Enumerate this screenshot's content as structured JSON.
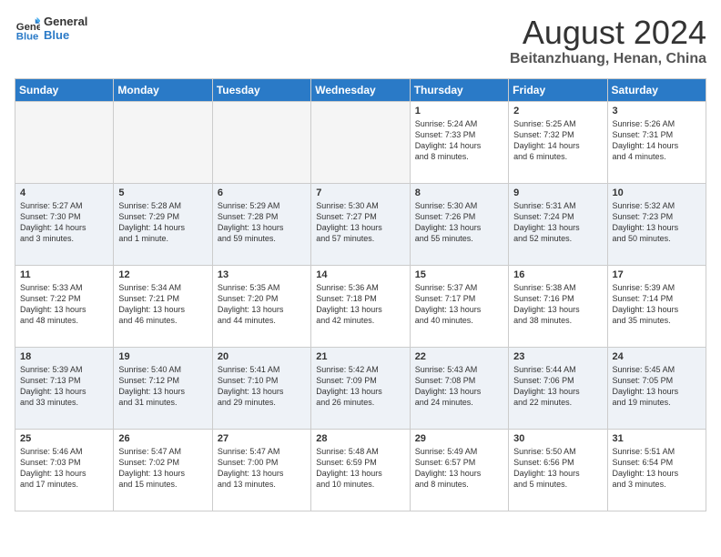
{
  "header": {
    "logo_line1": "General",
    "logo_line2": "Blue",
    "month": "August 2024",
    "location": "Beitanzhuang, Henan, China"
  },
  "weekdays": [
    "Sunday",
    "Monday",
    "Tuesday",
    "Wednesday",
    "Thursday",
    "Friday",
    "Saturday"
  ],
  "weeks": [
    [
      {
        "day": "",
        "info": ""
      },
      {
        "day": "",
        "info": ""
      },
      {
        "day": "",
        "info": ""
      },
      {
        "day": "",
        "info": ""
      },
      {
        "day": "1",
        "info": "Sunrise: 5:24 AM\nSunset: 7:33 PM\nDaylight: 14 hours\nand 8 minutes."
      },
      {
        "day": "2",
        "info": "Sunrise: 5:25 AM\nSunset: 7:32 PM\nDaylight: 14 hours\nand 6 minutes."
      },
      {
        "day": "3",
        "info": "Sunrise: 5:26 AM\nSunset: 7:31 PM\nDaylight: 14 hours\nand 4 minutes."
      }
    ],
    [
      {
        "day": "4",
        "info": "Sunrise: 5:27 AM\nSunset: 7:30 PM\nDaylight: 14 hours\nand 3 minutes."
      },
      {
        "day": "5",
        "info": "Sunrise: 5:28 AM\nSunset: 7:29 PM\nDaylight: 14 hours\nand 1 minute."
      },
      {
        "day": "6",
        "info": "Sunrise: 5:29 AM\nSunset: 7:28 PM\nDaylight: 13 hours\nand 59 minutes."
      },
      {
        "day": "7",
        "info": "Sunrise: 5:30 AM\nSunset: 7:27 PM\nDaylight: 13 hours\nand 57 minutes."
      },
      {
        "day": "8",
        "info": "Sunrise: 5:30 AM\nSunset: 7:26 PM\nDaylight: 13 hours\nand 55 minutes."
      },
      {
        "day": "9",
        "info": "Sunrise: 5:31 AM\nSunset: 7:24 PM\nDaylight: 13 hours\nand 52 minutes."
      },
      {
        "day": "10",
        "info": "Sunrise: 5:32 AM\nSunset: 7:23 PM\nDaylight: 13 hours\nand 50 minutes."
      }
    ],
    [
      {
        "day": "11",
        "info": "Sunrise: 5:33 AM\nSunset: 7:22 PM\nDaylight: 13 hours\nand 48 minutes."
      },
      {
        "day": "12",
        "info": "Sunrise: 5:34 AM\nSunset: 7:21 PM\nDaylight: 13 hours\nand 46 minutes."
      },
      {
        "day": "13",
        "info": "Sunrise: 5:35 AM\nSunset: 7:20 PM\nDaylight: 13 hours\nand 44 minutes."
      },
      {
        "day": "14",
        "info": "Sunrise: 5:36 AM\nSunset: 7:18 PM\nDaylight: 13 hours\nand 42 minutes."
      },
      {
        "day": "15",
        "info": "Sunrise: 5:37 AM\nSunset: 7:17 PM\nDaylight: 13 hours\nand 40 minutes."
      },
      {
        "day": "16",
        "info": "Sunrise: 5:38 AM\nSunset: 7:16 PM\nDaylight: 13 hours\nand 38 minutes."
      },
      {
        "day": "17",
        "info": "Sunrise: 5:39 AM\nSunset: 7:14 PM\nDaylight: 13 hours\nand 35 minutes."
      }
    ],
    [
      {
        "day": "18",
        "info": "Sunrise: 5:39 AM\nSunset: 7:13 PM\nDaylight: 13 hours\nand 33 minutes."
      },
      {
        "day": "19",
        "info": "Sunrise: 5:40 AM\nSunset: 7:12 PM\nDaylight: 13 hours\nand 31 minutes."
      },
      {
        "day": "20",
        "info": "Sunrise: 5:41 AM\nSunset: 7:10 PM\nDaylight: 13 hours\nand 29 minutes."
      },
      {
        "day": "21",
        "info": "Sunrise: 5:42 AM\nSunset: 7:09 PM\nDaylight: 13 hours\nand 26 minutes."
      },
      {
        "day": "22",
        "info": "Sunrise: 5:43 AM\nSunset: 7:08 PM\nDaylight: 13 hours\nand 24 minutes."
      },
      {
        "day": "23",
        "info": "Sunrise: 5:44 AM\nSunset: 7:06 PM\nDaylight: 13 hours\nand 22 minutes."
      },
      {
        "day": "24",
        "info": "Sunrise: 5:45 AM\nSunset: 7:05 PM\nDaylight: 13 hours\nand 19 minutes."
      }
    ],
    [
      {
        "day": "25",
        "info": "Sunrise: 5:46 AM\nSunset: 7:03 PM\nDaylight: 13 hours\nand 17 minutes."
      },
      {
        "day": "26",
        "info": "Sunrise: 5:47 AM\nSunset: 7:02 PM\nDaylight: 13 hours\nand 15 minutes."
      },
      {
        "day": "27",
        "info": "Sunrise: 5:47 AM\nSunset: 7:00 PM\nDaylight: 13 hours\nand 13 minutes."
      },
      {
        "day": "28",
        "info": "Sunrise: 5:48 AM\nSunset: 6:59 PM\nDaylight: 13 hours\nand 10 minutes."
      },
      {
        "day": "29",
        "info": "Sunrise: 5:49 AM\nSunset: 6:57 PM\nDaylight: 13 hours\nand 8 minutes."
      },
      {
        "day": "30",
        "info": "Sunrise: 5:50 AM\nSunset: 6:56 PM\nDaylight: 13 hours\nand 5 minutes."
      },
      {
        "day": "31",
        "info": "Sunrise: 5:51 AM\nSunset: 6:54 PM\nDaylight: 13 hours\nand 3 minutes."
      }
    ]
  ]
}
